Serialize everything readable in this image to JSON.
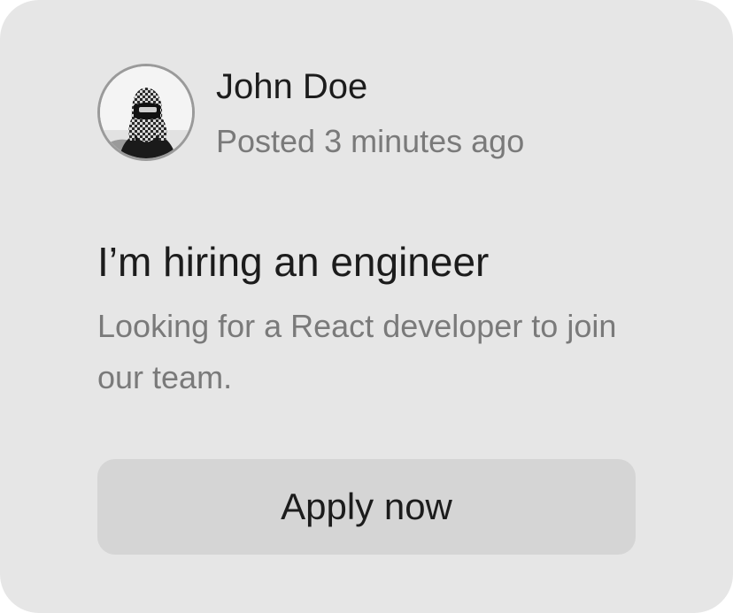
{
  "post": {
    "author": {
      "name": "John Doe",
      "avatar_icon": "user-avatar-photo"
    },
    "timestamp": "Posted 3 minutes ago",
    "title": "I’m hiring an engineer",
    "body": "Looking for a React developer to join our team.",
    "action": {
      "label": "Apply now"
    }
  },
  "colors": {
    "card_background": "#e6e6e6",
    "button_background": "#d5d5d5",
    "primary_text": "#1c1c1c",
    "secondary_text": "#7a7a7a"
  }
}
